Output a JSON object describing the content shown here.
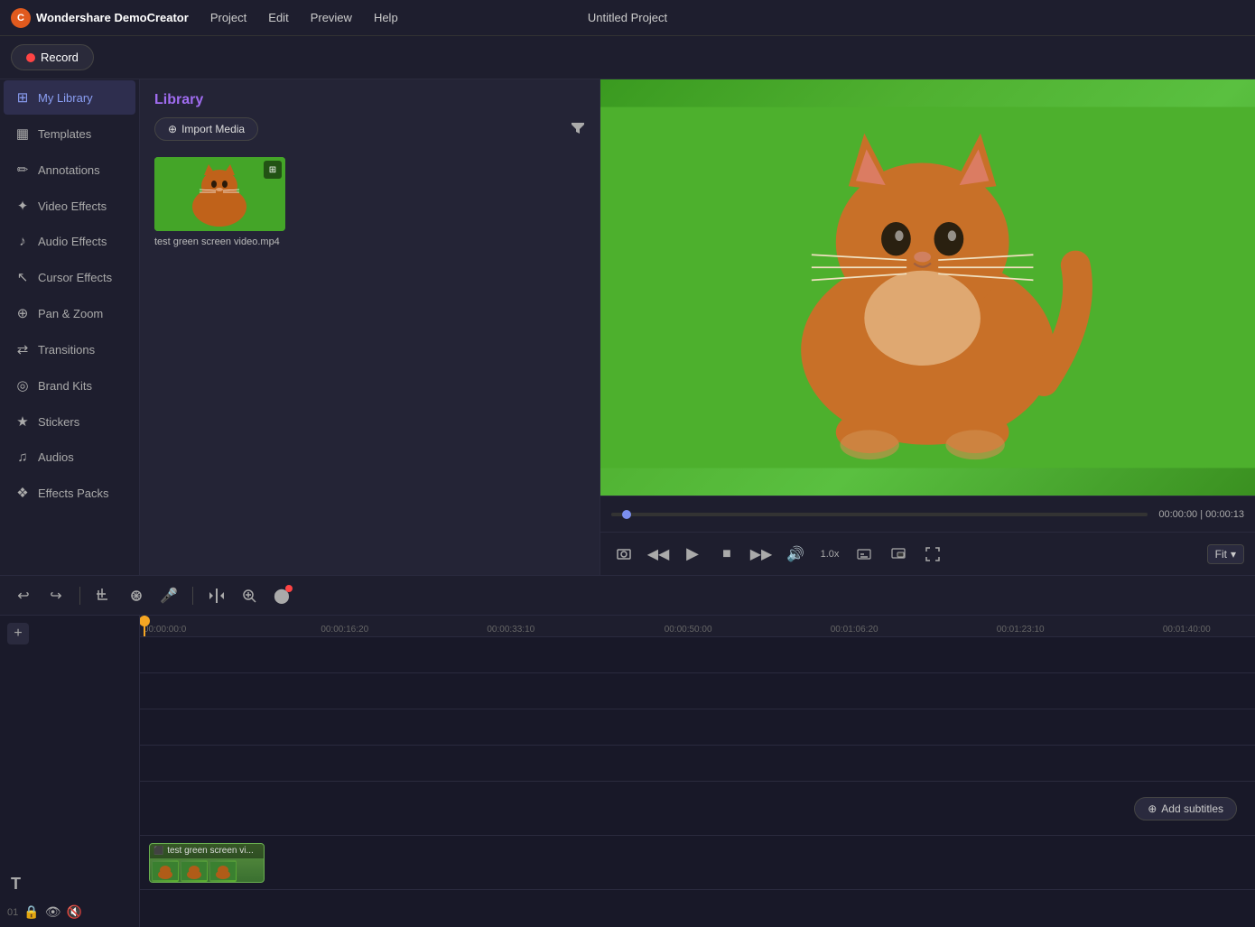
{
  "app": {
    "name": "Wondershare DemoCreator",
    "title": "Untitled Project",
    "logo_letter": "C"
  },
  "menubar": {
    "items": [
      "Project",
      "Edit",
      "Preview",
      "Help"
    ]
  },
  "toolbar": {
    "record_label": "Record"
  },
  "sidebar": {
    "items": [
      {
        "id": "my-library",
        "label": "My Library",
        "icon": "⊞",
        "active": true
      },
      {
        "id": "templates",
        "label": "Templates",
        "icon": "▦"
      },
      {
        "id": "annotations",
        "label": "Annotations",
        "icon": "✏"
      },
      {
        "id": "video-effects",
        "label": "Video Effects",
        "icon": "✦"
      },
      {
        "id": "audio-effects",
        "label": "Audio Effects",
        "icon": "♪"
      },
      {
        "id": "cursor-effects",
        "label": "Cursor Effects",
        "icon": "↖"
      },
      {
        "id": "pan-zoom",
        "label": "Pan & Zoom",
        "icon": "⊕"
      },
      {
        "id": "transitions",
        "label": "Transitions",
        "icon": "⇄"
      },
      {
        "id": "brand-kits",
        "label": "Brand Kits",
        "icon": "◎"
      },
      {
        "id": "stickers",
        "label": "Stickers",
        "icon": "★"
      },
      {
        "id": "audios",
        "label": "Audios",
        "icon": "♫"
      },
      {
        "id": "effects-packs",
        "label": "Effects Packs",
        "icon": "❖"
      }
    ]
  },
  "library": {
    "title": "Library",
    "import_label": "Import Media",
    "media_items": [
      {
        "id": "1",
        "filename": "test green screen video.mp4"
      }
    ]
  },
  "preview": {
    "current_time": "00:00:00",
    "total_time": "00:00:13",
    "fit_label": "Fit"
  },
  "timeline": {
    "ruler_labels": [
      "00:00:00:0",
      "00:00:16:20",
      "00:00:33:10",
      "00:00:50:00",
      "00:01:06:20",
      "00:01:23:10",
      "00:01:40:00"
    ],
    "add_subtitles_label": "Add subtitles",
    "clip_title": "test green screen vi..."
  }
}
